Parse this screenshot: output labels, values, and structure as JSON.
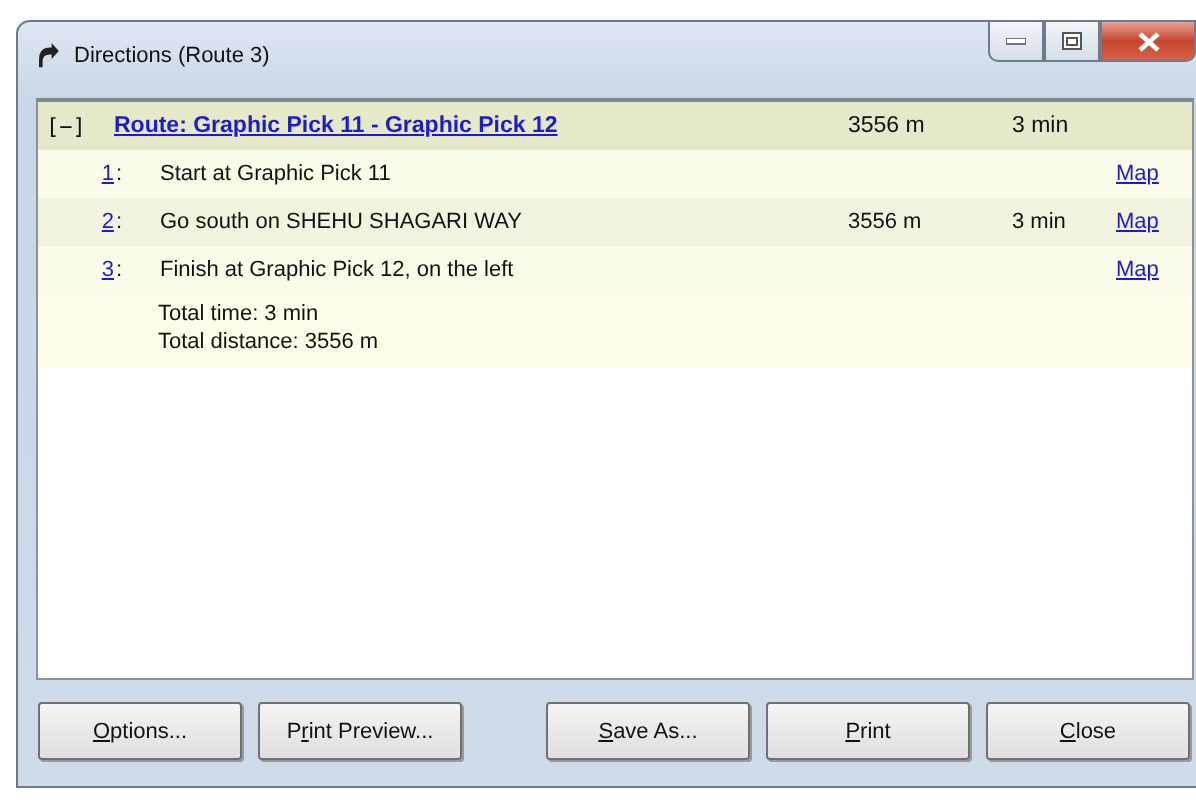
{
  "window": {
    "title": "Directions (Route 3)"
  },
  "route": {
    "toggle": "[−]",
    "title": "Route: Graphic Pick 11 - Graphic Pick 12",
    "distance": "3556 m",
    "time": "3 min",
    "steps": [
      {
        "number": "1",
        "separator": ":",
        "text": "Start at Graphic Pick 11",
        "link": "Map"
      },
      {
        "number": "2",
        "separator": ":",
        "text": "Go south on SHEHU SHAGARI WAY",
        "distance": "3556 m",
        "time": "3 min",
        "link": "Map"
      },
      {
        "number": "3",
        "separator": ":",
        "text": "Finish at Graphic Pick 12, on the left",
        "link": "Map"
      }
    ],
    "totals": [
      "Total time: 3 min",
      "Total distance: 3556 m"
    ]
  },
  "buttons": [
    {
      "key": "O",
      "post": "ptions..."
    },
    {
      "pre": "P",
      "key": "r",
      "post": "int Preview..."
    },
    {
      "key": "S",
      "post": "ave As..."
    },
    {
      "key": "P",
      "post": "rint"
    },
    {
      "key": "C",
      "post": "lose"
    }
  ]
}
